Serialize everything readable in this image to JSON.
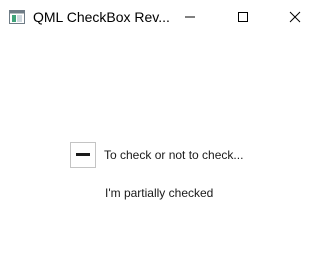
{
  "window": {
    "title": "QML CheckBox Rev..."
  },
  "titlebar": {
    "icons": {
      "app": "app-window-icon",
      "minimize": "minimize-icon",
      "maximize": "maximize-icon",
      "close": "close-icon"
    }
  },
  "checkbox": {
    "label": "To check or not to check...",
    "state": "partially-checked",
    "state_icon": "dash-icon"
  },
  "status": {
    "text": "I'm partially checked"
  },
  "colors": {
    "background": "#ffffff",
    "text": "#1a1a1a",
    "checkbox_border": "#c4c4c4",
    "indicator": "#1a1a1a",
    "app_icon_frame": "#6f7c86",
    "app_icon_accent": "#3fa37a"
  }
}
